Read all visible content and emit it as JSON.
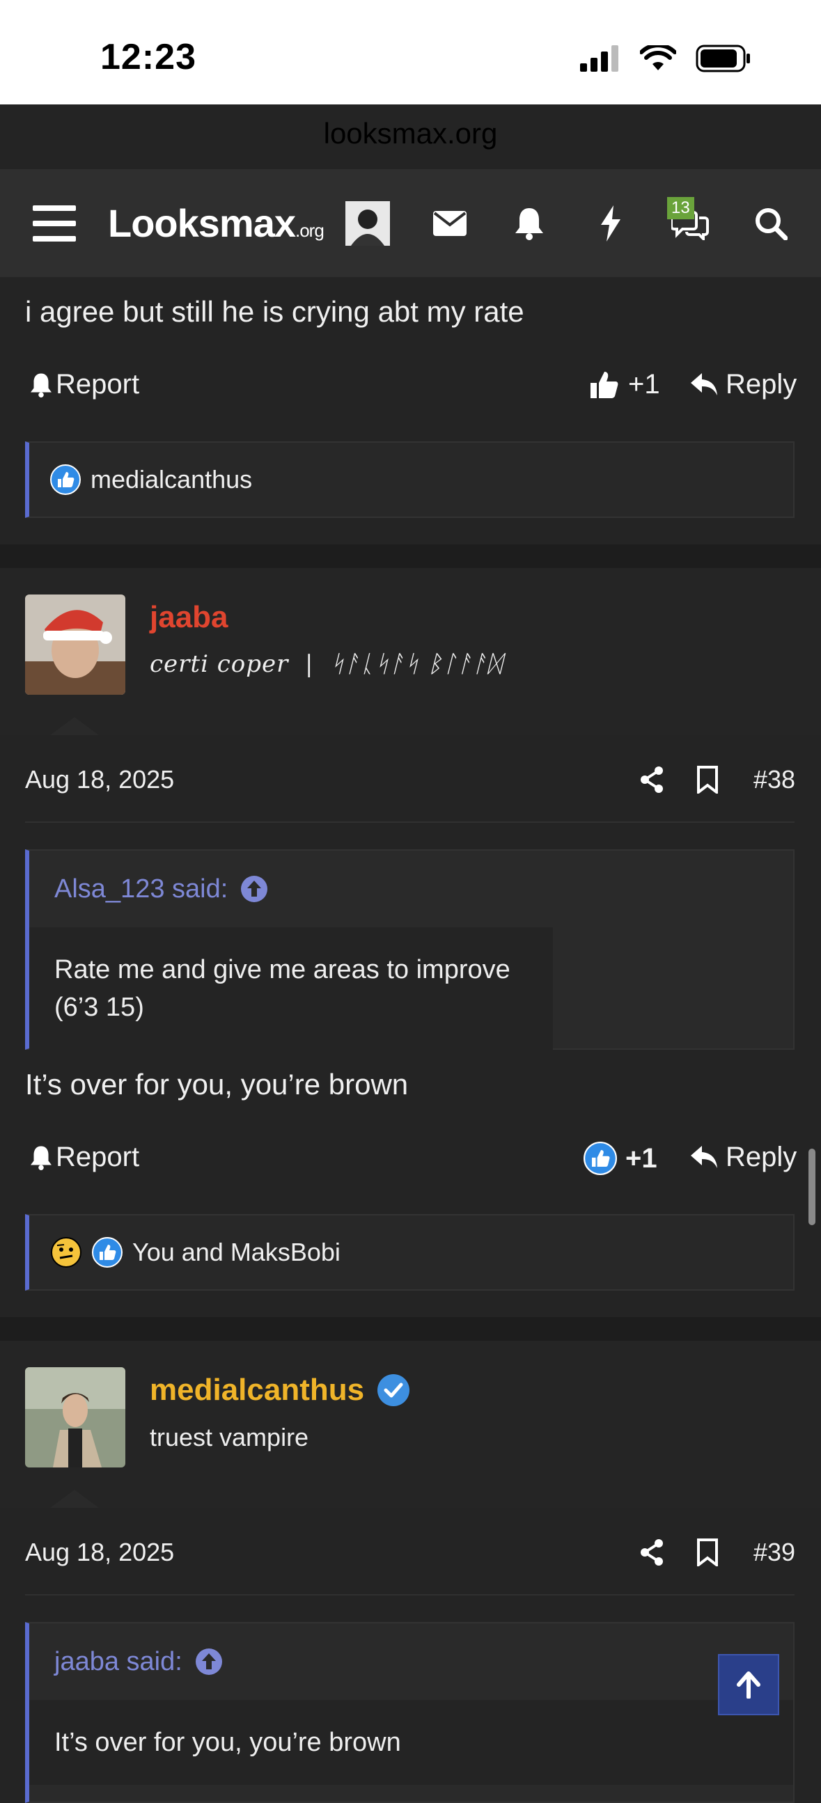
{
  "status": {
    "time": "12:23"
  },
  "browser": {
    "url": "looksmax.org"
  },
  "nav": {
    "logo_main": "Looksmax",
    "logo_suffix": ".org",
    "chat_badge": "13"
  },
  "post37": {
    "text": "i agree but still he is crying abt my rate",
    "report": "Report",
    "like_count": "+1",
    "reply": "Reply",
    "reactions_text": "medialcanthus"
  },
  "post38": {
    "username": "jaaba",
    "user_title": "certi coper  |  ᛋᚨᚳᛋᚨᛋ ᛒᛚᚨᚨᛞ",
    "date": "Aug 18, 2025",
    "number": "#38",
    "quote_author": "Alsa_123 said:",
    "quote_text": "Rate me and give me areas to improve (6’3 15)",
    "text": "It’s over for you, you’re brown",
    "report": "Report",
    "like_count": "+1",
    "reply": "Reply",
    "reactions_text": "You and MaksBobi"
  },
  "post39": {
    "username": "medialcanthus",
    "user_title": "truest vampire",
    "date": "Aug 18, 2025",
    "number": "#39",
    "quote_author": "jaaba said:",
    "quote_text": "It’s over for you, you’re brown"
  },
  "colors": {
    "accent_blue": "#5a6bd0",
    "username_red": "#e0452f",
    "username_gold": "#f0b429",
    "verified_blue": "#3d8fe0",
    "badge_green": "#6aa33b"
  }
}
